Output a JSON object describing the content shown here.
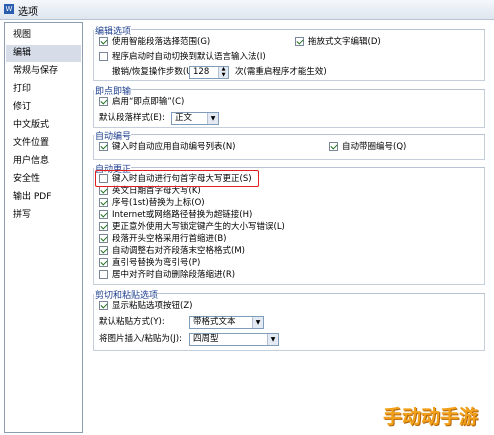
{
  "window": {
    "title": "选项"
  },
  "sidebar": {
    "items": [
      {
        "label": "视图",
        "selected": false
      },
      {
        "label": "编辑",
        "selected": true
      },
      {
        "label": "常规与保存",
        "selected": false
      },
      {
        "label": "打印",
        "selected": false
      },
      {
        "label": "修订",
        "selected": false
      },
      {
        "label": "中文版式",
        "selected": false
      },
      {
        "label": "文件位置",
        "selected": false
      },
      {
        "label": "用户信息",
        "selected": false
      },
      {
        "label": "安全性",
        "selected": false
      },
      {
        "label": "输出 PDF",
        "selected": false
      },
      {
        "label": "拼写",
        "selected": false
      }
    ]
  },
  "edit_options": {
    "title": "编辑选项",
    "smart_select": {
      "label": "使用智能段落选择范围(G)",
      "checked": true
    },
    "drag_drop": {
      "label": "拖放式文字编辑(D)",
      "checked": true
    },
    "auto_ime": {
      "label": "程序启动时自动切换到默认语言输入法(I)",
      "checked": false
    },
    "undo_label": "撤销/恢复操作步数(U):",
    "undo_value": "128",
    "undo_suffix": "次(需重启程序才能生效)"
  },
  "click_type": {
    "title": "即点即输",
    "enable": {
      "label": "启用“即点即输”(C)",
      "checked": true
    },
    "style_label": "默认段落样式(E):",
    "style_value": "正文"
  },
  "auto_number": {
    "title": "自动编号",
    "auto_list": {
      "label": "键入时自动应用自动编号列表(N)",
      "checked": true
    },
    "circled": {
      "label": "自动带圈编号(Q)",
      "checked": true
    }
  },
  "autocorrect": {
    "title": "自动更正",
    "items": [
      {
        "label": "键入时自动进行句首字母大写更正(S)",
        "checked": false
      },
      {
        "label": "英文日期首字母大写(K)",
        "checked": true
      },
      {
        "label": "序号(1st)替换为上标(O)",
        "checked": true
      },
      {
        "label": "Internet或网络路径替换为超链接(H)",
        "checked": true
      },
      {
        "label": "更正意外使用大写锁定键产生的大小写错误(L)",
        "checked": true
      },
      {
        "label": "段落开头空格采用行首缩进(B)",
        "checked": true
      },
      {
        "label": "自动调整右对齐段落末空格格式(M)",
        "checked": true
      },
      {
        "label": "直引号替换为弯引号(P)",
        "checked": true
      },
      {
        "label": "居中对齐时自动删除段落缩进(R)",
        "checked": false
      }
    ]
  },
  "clipboard": {
    "title": "剪切和粘贴选项",
    "show_paste_btn": {
      "label": "显示粘贴选项按钮(Z)",
      "checked": true
    },
    "default_paste_label": "默认粘贴方式(Y):",
    "default_paste_value": "带格式文本",
    "image_paste_label": "将图片插入/粘贴为(J):",
    "image_paste_value": "四周型"
  },
  "watermark": "手动动手游",
  "colors": {
    "group_title": "#1d3f8f",
    "selected_nav": "#d6dde8",
    "highlight": "#e02020"
  }
}
